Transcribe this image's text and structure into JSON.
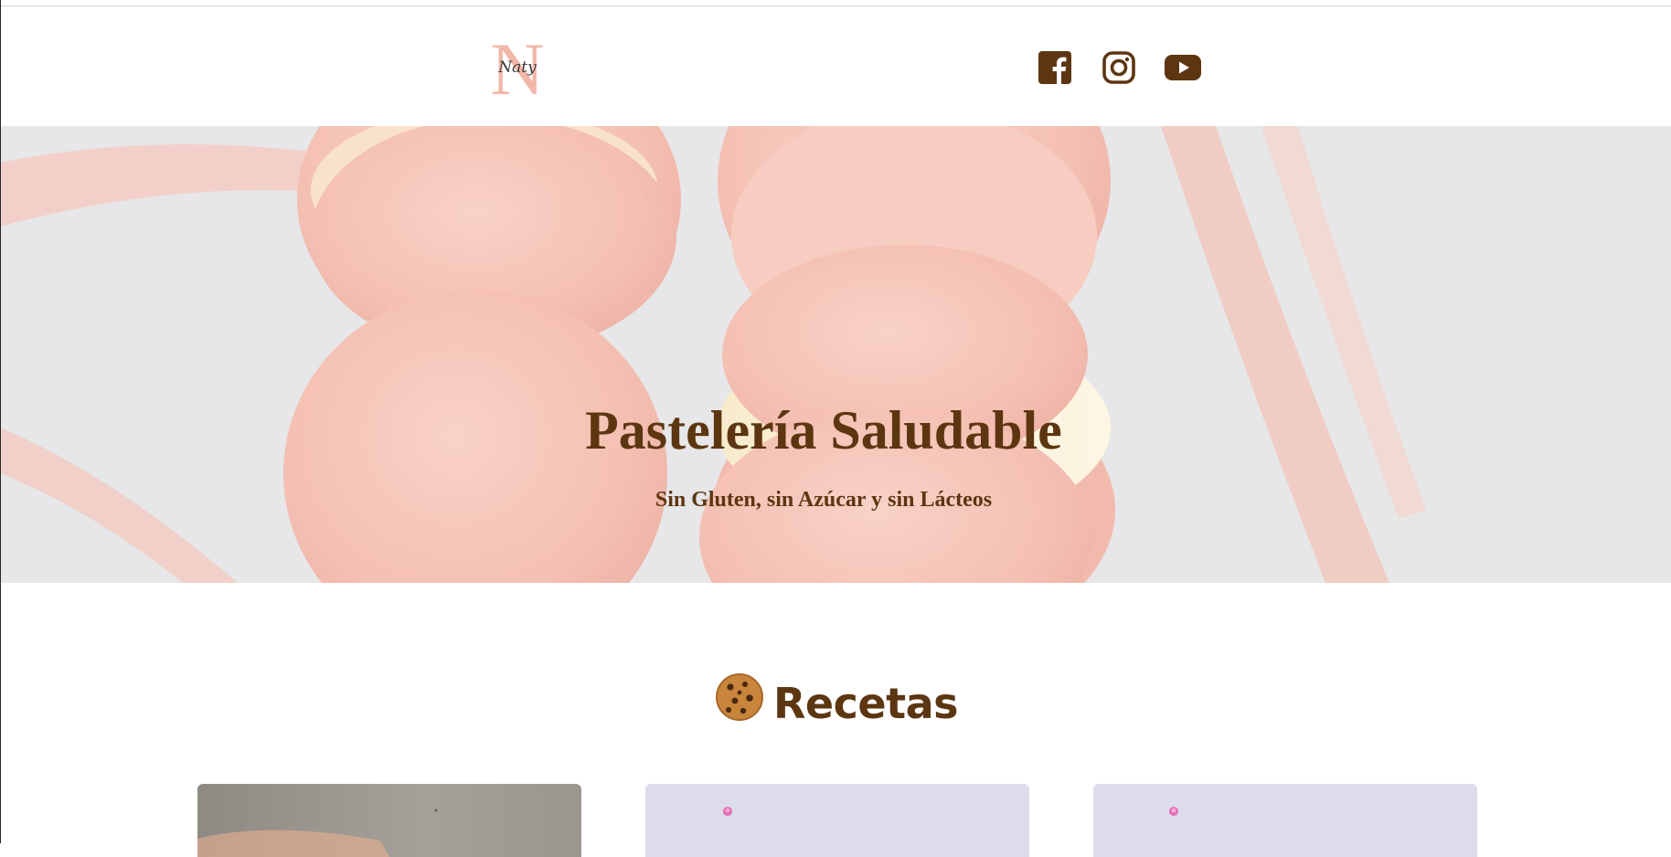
{
  "header": {
    "logo_text": "Naty",
    "social": [
      {
        "name": "facebook"
      },
      {
        "name": "instagram"
      },
      {
        "name": "youtube"
      }
    ]
  },
  "hero": {
    "title": "Pastelería Saludable",
    "subtitle": "Sin Gluten, sin Azúcar y sin Lácteos"
  },
  "recipes": {
    "title": "Recetas",
    "icon": "cookie-icon"
  },
  "colors": {
    "brand": "#5c3611",
    "macaron": "#f4b4a4",
    "hero_background": "#e1e0e2"
  }
}
